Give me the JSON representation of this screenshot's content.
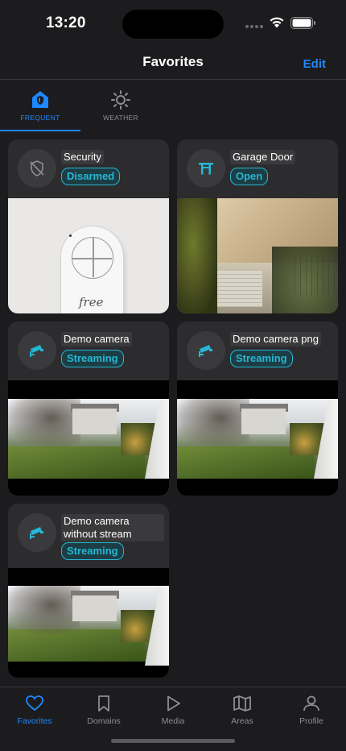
{
  "status_bar": {
    "time": "13:20",
    "wifi_icon": "wifi-icon",
    "battery_icon": "battery-icon"
  },
  "nav": {
    "title": "Favorites",
    "edit_label": "Edit"
  },
  "top_tabs": [
    {
      "label": "FREQUENT",
      "icon": "home-shield-icon",
      "active": true
    },
    {
      "label": "WEATHER",
      "icon": "sun-icon",
      "active": false
    }
  ],
  "cards": [
    {
      "title": "Security",
      "state": "Disarmed",
      "icon": "shield-off-icon"
    },
    {
      "title": "Garage Door",
      "state": "Open",
      "icon": "garage-gate-icon"
    },
    {
      "title": "Demo camera",
      "state": "Streaming",
      "icon": "cctv-icon"
    },
    {
      "title": "Demo camera png",
      "state": "Streaming",
      "icon": "cctv-icon"
    },
    {
      "title": "Demo camera without stream",
      "state": "Streaming",
      "icon": "cctv-icon"
    }
  ],
  "camera_overlay": {
    "remote_brand": "free"
  },
  "tab_bar": [
    {
      "label": "Favorites",
      "icon": "heart-icon",
      "active": true
    },
    {
      "label": "Domains",
      "icon": "bookmark-icon",
      "active": false
    },
    {
      "label": "Media",
      "icon": "play-icon",
      "active": false
    },
    {
      "label": "Areas",
      "icon": "map-icon",
      "active": false
    },
    {
      "label": "Profile",
      "icon": "person-icon",
      "active": false
    }
  ],
  "colors": {
    "accent": "#1e88ff",
    "state_teal": "#26b7d4",
    "background": "#1c1c1e",
    "card": "#2c2c2e"
  }
}
